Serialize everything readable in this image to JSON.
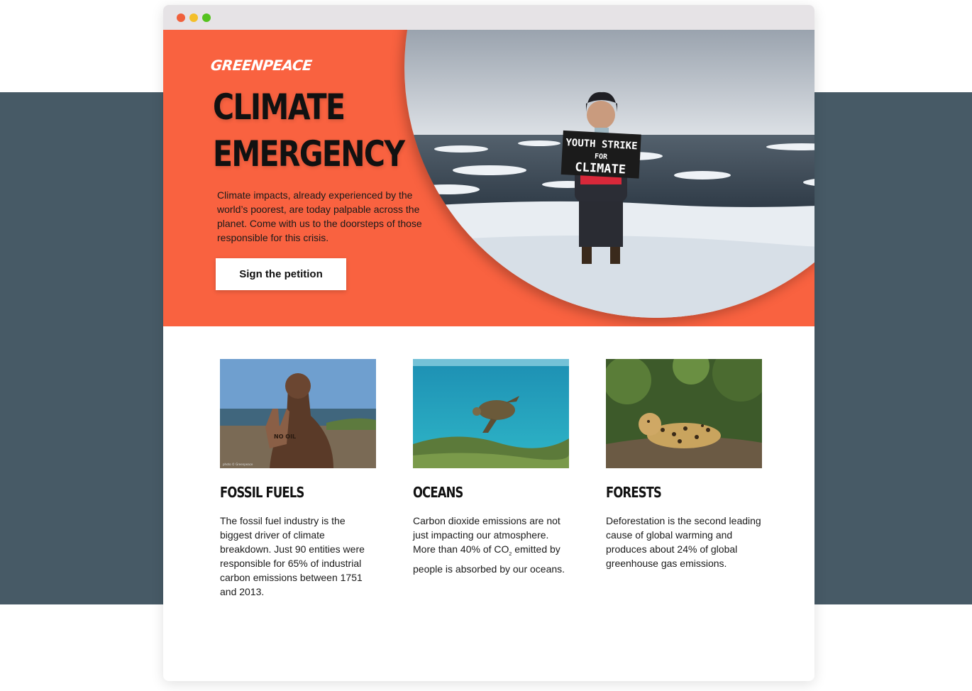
{
  "hero": {
    "logo": "GREENPEACE",
    "title_line1": "CLIMATE",
    "title_line2": "EMERGENCY",
    "description": "Climate impacts, already experienced by the world’s poorest, are today palpable across the planet. Come with us to the doorsteps of those responsible for this crisis.",
    "cta_label": "Sign the petition",
    "sign": {
      "line1": "YOUTH STRIKE",
      "line2": "FOR",
      "line3": "CLIMATE"
    }
  },
  "cards": [
    {
      "title": "FOSSIL FUELS",
      "description": "The fossil fuel industry is the biggest driver of climate breakdown. Just 90 entities were responsible for 65% of industrial carbon emissions between 1751 and 2013.",
      "hand_text": "NO OIL",
      "credit": "photo © Greenpeace"
    },
    {
      "title": "OCEANS",
      "description_before": "Carbon dioxide emissions are not just impacting our atmosphere. More than 40% of CO",
      "description_sub": "2",
      "description_after": " emitted by people is absorbed by our oceans."
    },
    {
      "title": "FORESTS",
      "description": "Deforestation is the second leading cause of global warming and produces about 24% of global greenhouse gas emissions."
    }
  ],
  "colors": {
    "hero_orange": "#f96240",
    "band_slate": "#475a66",
    "titlebar": "#e6e3e6",
    "close": "#f0603c",
    "minimize": "#f4bf2a",
    "maximize": "#55c21f"
  }
}
